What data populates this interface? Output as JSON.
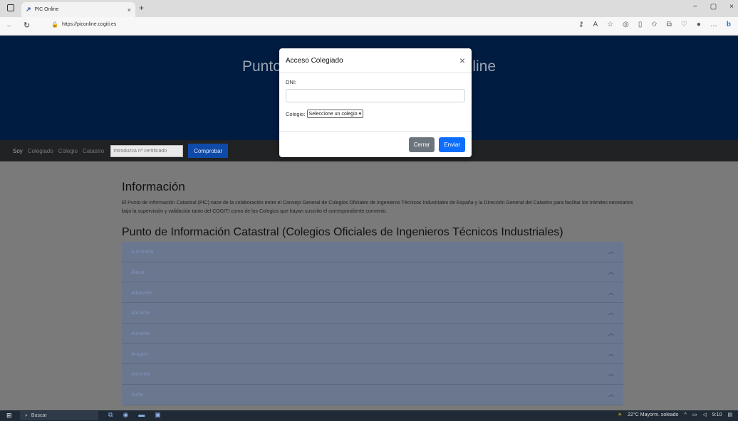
{
  "browser": {
    "tab_title": "PIC Online",
    "tab_close": "×",
    "new_tab": "+",
    "url": "https://piconline.cogiti.es",
    "window_controls": [
      "−",
      "▢",
      "×"
    ]
  },
  "hero": {
    "title": "Punto de Información Catastral Online"
  },
  "navbar": {
    "items": [
      "Soy",
      "Colegiado",
      "Colegio",
      "Catastro"
    ],
    "cert_placeholder": "Introduzca nº certificado",
    "check_button": "Comprobar"
  },
  "info": {
    "title": "Información",
    "text": "El Punto de Información Catastral (PIC) nace de la colaboración entre el Consejo General de Colegios Oficiales de Ingenieros Técnicos Industriales de España y la Dirección General del Catastro para facilitar los trámites necesarios bajo la supervisión y validación tanto del COGITI como de los Colegios que hayan suscrito el correspondiente convenio."
  },
  "pic": {
    "title": "Punto de Información Catastral (Colegios Oficiales de Ingenieros Técnicos Industriales)",
    "colegios": [
      "A Coruña",
      "Álava",
      "Albacete",
      "Alicante",
      "Almería",
      "Aragón",
      "Asturias",
      "Ávila"
    ]
  },
  "modal": {
    "title": "Acceso Colegiado",
    "dni_label": "DNI:",
    "colegio_label": "Colegio:",
    "colegio_selected": "Seleccione un colegio",
    "close_button": "Cerrar",
    "submit_button": "Enviar"
  },
  "taskbar": {
    "search_label": "Buscar",
    "weather": "22°C  Mayorm. soleado",
    "time": "9:10"
  }
}
